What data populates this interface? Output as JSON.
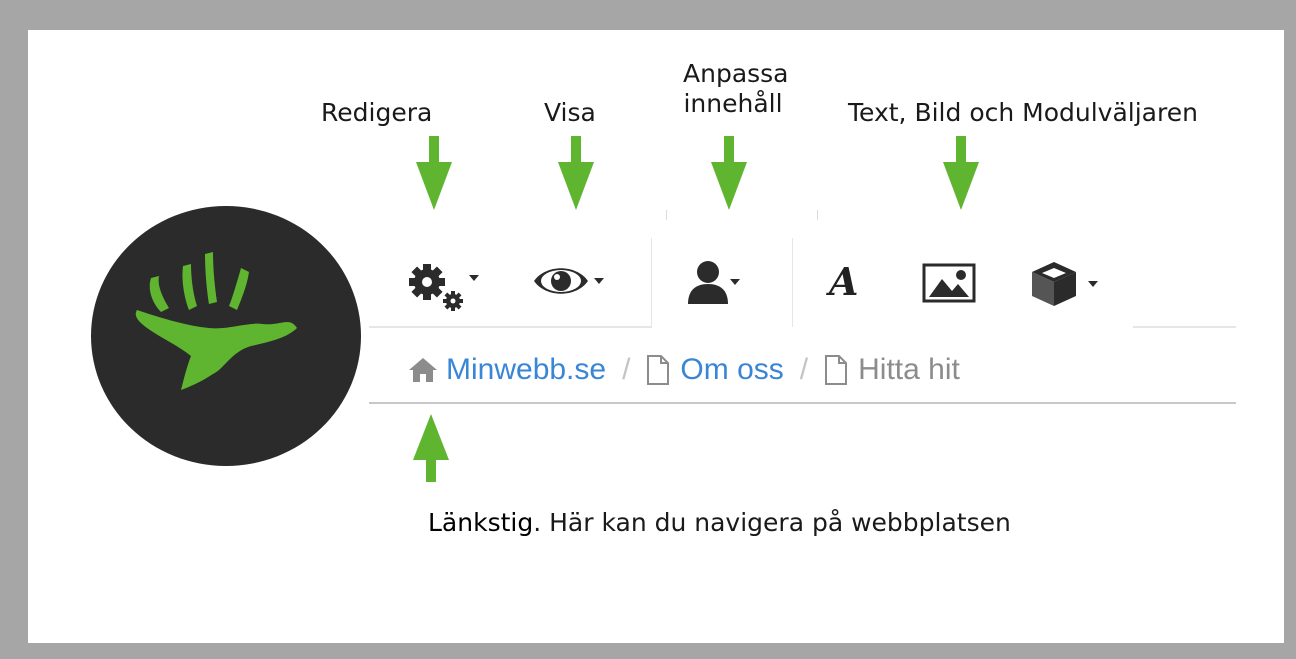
{
  "annotations": {
    "redigera": "Redigera",
    "visa": "Visa",
    "anpassa_line1": "Anpassa",
    "anpassa_line2": "innehåll",
    "text_bild": "Text, Bild och Modulväljaren"
  },
  "toolbar": {
    "icons": [
      "gears-icon",
      "eye-icon",
      "user-icon",
      "font-icon",
      "image-icon",
      "cube-icon"
    ],
    "font_glyph": "A"
  },
  "breadcrumb": {
    "items": [
      {
        "label": "Minwebb.se",
        "icon": "home-icon"
      },
      {
        "label": "Om oss",
        "icon": "page-icon"
      },
      {
        "label": "Hitta hit",
        "icon": "page-icon"
      }
    ],
    "separator": "/"
  },
  "caption": {
    "highlight": "Länkstig",
    "rest": ". Här kan du navigera på webbplatsen"
  },
  "colors": {
    "arrow_green": "#5fb52f",
    "link_blue": "#3a86d6",
    "logo_bg": "#2b2b2b",
    "frame_grey": "#a6a6a6"
  }
}
